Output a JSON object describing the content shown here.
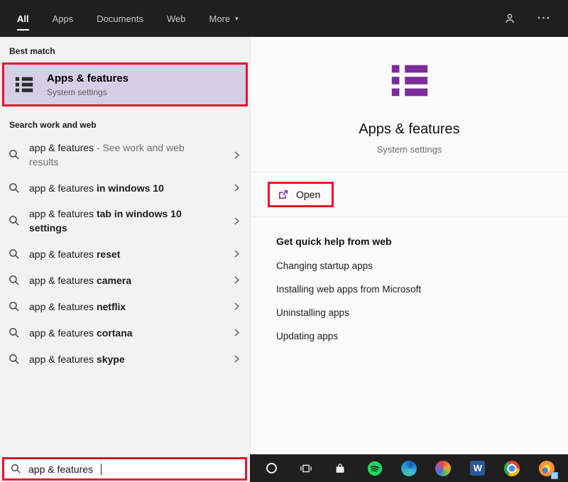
{
  "colors": {
    "accent_purple": "#7b2d9a",
    "annotation_red": "#e8112d",
    "best_match_bg": "#d5cee7",
    "topbar_bg": "#1f1f1f",
    "left_bg": "#f2f2f2",
    "right_bg": "#fbfbfb"
  },
  "topbar": {
    "tabs": [
      {
        "label": "All",
        "active": true
      },
      {
        "label": "Apps",
        "active": false
      },
      {
        "label": "Documents",
        "active": false
      },
      {
        "label": "Web",
        "active": false
      },
      {
        "label": "More",
        "active": false,
        "dropdown": true
      }
    ],
    "more_caret": "▾",
    "ellipsis_glyph": "⋯"
  },
  "left": {
    "best_match_header": "Best match",
    "best_match": {
      "title": "Apps & features",
      "subtitle": "System settings",
      "icon": "apps-features-icon"
    },
    "suggestions_header": "Search work and web",
    "suggestions": [
      {
        "prefix": "app & features",
        "bold": "",
        "gray": " - See work and web results"
      },
      {
        "prefix": "app & features ",
        "bold": "in windows 10",
        "gray": ""
      },
      {
        "prefix": "app & features ",
        "bold": "tab in windows 10 settings",
        "gray": ""
      },
      {
        "prefix": "app & features ",
        "bold": "reset",
        "gray": ""
      },
      {
        "prefix": "app & features ",
        "bold": "camera",
        "gray": ""
      },
      {
        "prefix": "app & features ",
        "bold": "netflix",
        "gray": ""
      },
      {
        "prefix": "app & features ",
        "bold": "cortana",
        "gray": ""
      },
      {
        "prefix": "app & features ",
        "bold": "skype",
        "gray": ""
      }
    ]
  },
  "preview": {
    "title": "Apps & features",
    "subtitle": "System settings",
    "open_label": "Open",
    "help_header": "Get quick help from web",
    "links": [
      "Changing startup apps",
      "Installing web apps from Microsoft",
      "Uninstalling apps",
      "Updating apps"
    ]
  },
  "search": {
    "value": "app & features",
    "icon": "search-icon"
  },
  "taskbar": {
    "icons": [
      {
        "name": "cortana-icon"
      },
      {
        "name": "task-view-icon"
      },
      {
        "name": "store-icon"
      },
      {
        "name": "spotify-icon"
      },
      {
        "name": "edge-icon"
      },
      {
        "name": "paint3d-icon"
      },
      {
        "name": "word-icon",
        "glyph": "W"
      },
      {
        "name": "chrome-icon"
      },
      {
        "name": "firefox-icon"
      }
    ]
  }
}
